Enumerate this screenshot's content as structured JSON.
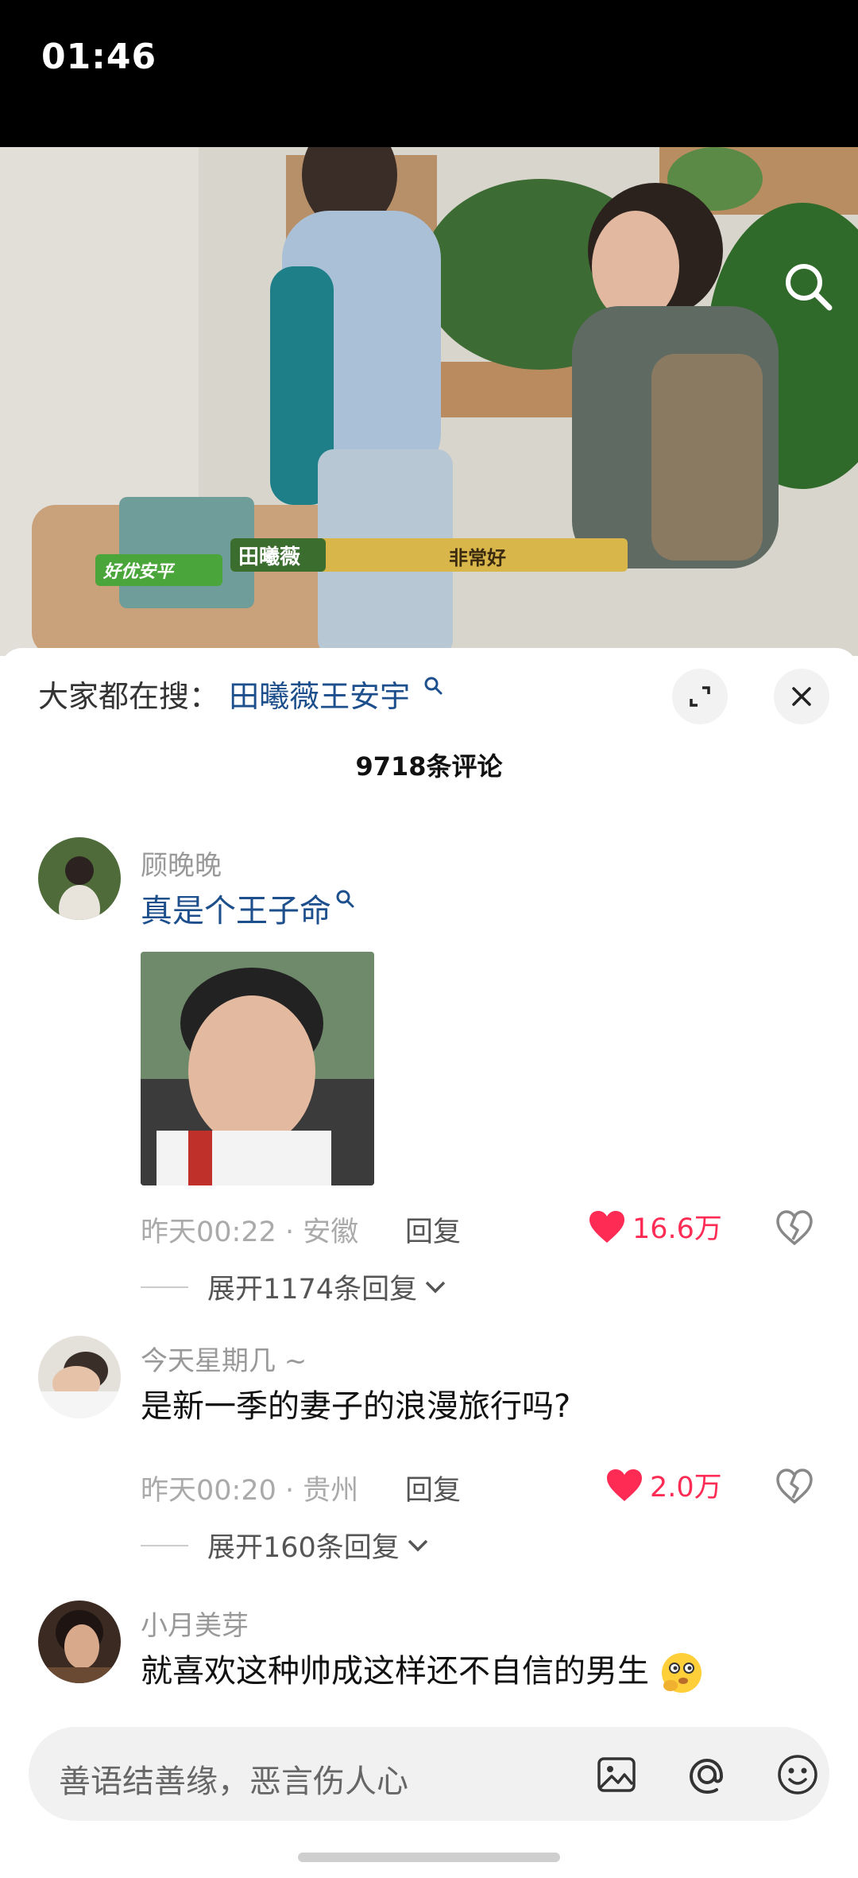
{
  "status": {
    "time": "01:46"
  },
  "video": {
    "caption_name": "田曦薇",
    "caption_text": "非常好",
    "logo_text": "好优安平"
  },
  "sheet": {
    "hot_search_prefix": "大家都在搜：",
    "hot_search_term": "田曦薇王安宇",
    "comment_count": "9718条评论"
  },
  "comments": [
    {
      "username": "顾晚晚",
      "text": "真是个王子命",
      "text_is_search_link": true,
      "time": "昨天00:22",
      "location": "安徽",
      "reply_label": "回复",
      "likes": "16.6万",
      "expand_label": "展开1174条回复"
    },
    {
      "username": "今天星期几 ~",
      "text": "是新一季的妻子的浪漫旅行吗?",
      "time": "昨天00:20",
      "location": "贵州",
      "reply_label": "回复",
      "likes": "2.0万",
      "expand_label": "展开160条回复"
    },
    {
      "username": "小月美芽",
      "text": "就喜欢这种帅成这样还不自信的男生"
    }
  ],
  "input": {
    "placeholder": "善语结善缘，恶言伤人心"
  },
  "colors": {
    "accent_red": "#fe2c55",
    "link_blue": "#1d4f8c"
  }
}
